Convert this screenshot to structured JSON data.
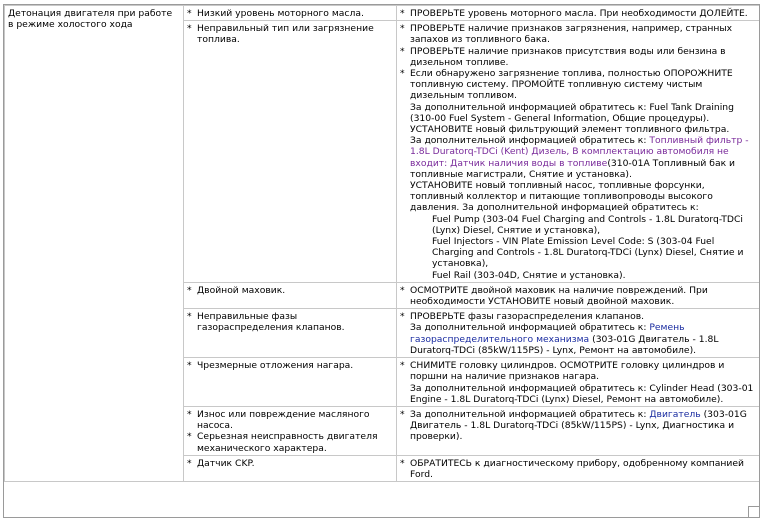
{
  "symptom": "Детонация двигателя при работе в режиме холостого хода",
  "rows": [
    {
      "causes": [
        "Низкий уровень моторного масла."
      ],
      "actions": [
        {
          "type": "bullet",
          "text": "ПРОВЕРЬТЕ уровень моторного масла. При необходимости ДОЛЕЙТЕ."
        }
      ]
    },
    {
      "causes": [
        "Неправильный тип или загрязнение топлива."
      ],
      "actions": [
        {
          "type": "bullet",
          "text": "ПРОВЕРЬТЕ наличие признаков загрязнения, например, странных запахов из топливного бака."
        },
        {
          "type": "bullet",
          "text": "ПРОВЕРЬТЕ наличие признаков присутствия воды или бензина в дизельном топливе."
        },
        {
          "type": "bullet",
          "text": "Если обнаружено загрязнение топлива, полностью ОПОРОЖНИТЕ топливную систему. ПРОМОЙТЕ топливную систему чистым дизельным топливом."
        },
        {
          "type": "plain",
          "text": "За дополнительной информацией обратитесь к: Fuel Tank Draining (310-00 Fuel System - General Information, Общие процедуры)."
        },
        {
          "type": "plain",
          "text": "УСТАНОВИТЕ новый фильтрующий элемент топливного фильтра."
        },
        {
          "type": "link",
          "pre": "За дополнительной информацией обратитесь к: ",
          "link": "Топливный фильтр - 1.8L Duratorq-TDCi (Kent) Дизель, В комплектацию автомобиля не входит: Датчик наличия воды в топливе",
          "post": "(310-01A Топливный бак и топливные магистрали, Снятие и установка)."
        },
        {
          "type": "plain",
          "text": "УСТАНОВИТЕ новый топливный насос, топливные форсунки, топливный коллектор и питающие топливопроводы высокого давления. За дополнительной информацией обратитесь к:"
        },
        {
          "type": "indent",
          "text": "Fuel Pump (303-04 Fuel Charging and Controls - 1.8L Duratorq-TDCi (Lynx) Diesel, Снятие и установка),"
        },
        {
          "type": "indent",
          "text": "Fuel Injectors - VIN Plate Emission Level Code: S (303-04 Fuel Charging and Controls - 1.8L Duratorq-TDCi (Lynx) Diesel, Снятие и установка),"
        },
        {
          "type": "indent",
          "text": "Fuel Rail (303-04D, Снятие и установка)."
        }
      ]
    },
    {
      "causes": [
        "Двойной маховик."
      ],
      "actions": [
        {
          "type": "bullet",
          "text": "ОСМОТРИТЕ двойной маховик на наличие повреждений. При необходимости УСТАНОВИТЕ новый двойной маховик."
        }
      ]
    },
    {
      "causes": [
        "Неправильные фазы газораспределения клапанов."
      ],
      "actions": [
        {
          "type": "bullet",
          "text": "ПРОВЕРЬТЕ фазы газораспределения клапанов."
        },
        {
          "type": "link2",
          "pre": "За дополнительной информацией обратитесь к: ",
          "link": "Ремень газораспределительного механизма",
          "post": " (303-01G Двигатель - 1.8L Duratorq-TDCi (85kW/115PS) - Lynx, Ремонт на автомобиле)."
        }
      ]
    },
    {
      "causes": [
        "Чрезмерные отложения нагара."
      ],
      "actions": [
        {
          "type": "bullet",
          "text": "СНИМИТЕ головку цилиндров. ОСМОТРИТЕ головку цилиндров и поршни на наличие признаков нагара."
        },
        {
          "type": "plain",
          "text": "За дополнительной информацией обратитесь к: Cylinder Head (303-01 Engine - 1.8L Duratorq-TDCi (Lynx) Diesel, Ремонт на автомобиле)."
        }
      ]
    },
    {
      "causes": [
        "Износ или повреждение масляного насоса.",
        "Серьезная неисправность двигателя механического характера."
      ],
      "actions": [
        {
          "type": "bulletlink",
          "pre": "За дополнительной информацией обратитесь к: ",
          "link": "Двигатель",
          "post": " (303-01G Двигатель - 1.8L Duratorq-TDCi (85kW/115PS) - Lynx, Диагностика и проверки)."
        }
      ]
    },
    {
      "causes": [
        "Датчик CKP."
      ],
      "actions": [
        {
          "type": "bullet",
          "text": "ОБРАТИТЕСЬ к диагностическому прибору, одобренному компанией Ford."
        }
      ]
    }
  ]
}
